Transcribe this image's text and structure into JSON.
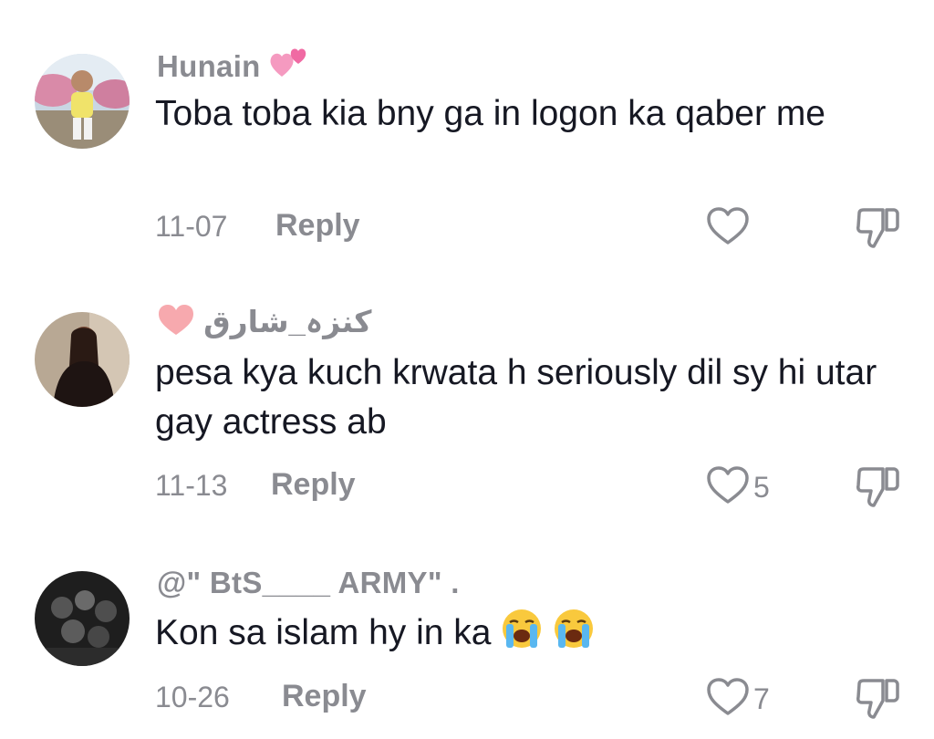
{
  "comments": [
    {
      "username": "Hunain",
      "username_emoji": "two-hearts-emoji",
      "text": "Toba toba kia bny ga in logon ka qaber me",
      "date": "11-07",
      "reply_label": "Reply",
      "like_count": ""
    },
    {
      "username": "كنزہ_شارق",
      "username_emoji": "pink-heart-emoji",
      "text": "pesa kya kuch krwata h seriously dil sy hi utar gay actress ab",
      "date": "11-13",
      "reply_label": "Reply",
      "like_count": "5"
    },
    {
      "username": "@\" BtS____ ARMY\" .",
      "text": "Kon sa islam hy in ka",
      "text_emojis": [
        "loudly-crying-emoji",
        "loudly-crying-emoji"
      ],
      "date": "10-26",
      "reply_label": "Reply",
      "like_count": "7"
    }
  ],
  "icons": {
    "like": "heart-outline-icon",
    "dislike": "thumbs-down-outline-icon"
  },
  "colors": {
    "text": "#161823",
    "muted": "#8a8b91"
  }
}
